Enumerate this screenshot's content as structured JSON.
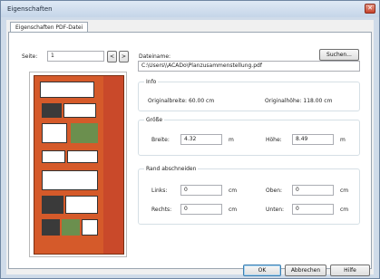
{
  "window": {
    "title": "Eigenschaften",
    "close_glyph": "✕"
  },
  "tab": {
    "label": "Eigenschaften PDF-Datei"
  },
  "page": {
    "label": "Seite:",
    "value": "1",
    "prev": "<",
    "next": ">"
  },
  "file": {
    "label": "Dateiname:",
    "path": "C:\\Users\\\\ACADo\\Planzusammenstellung.pdf",
    "browse": "Suchen..."
  },
  "info": {
    "title": "Info",
    "orig_width_label": "Originalbreite: 60.00 cm",
    "orig_height_label": "Originalhöhe:  118.00 cm"
  },
  "size": {
    "title": "Größe",
    "width_label": "Breite:",
    "width_value": "4.32",
    "width_unit": "m",
    "height_label": "Höhe:",
    "height_value": "8.49",
    "height_unit": "m"
  },
  "crop": {
    "title": "Rand abschneiden",
    "left_label": "Links:",
    "left_value": "0",
    "left_unit": "cm",
    "top_label": "Oben:",
    "top_value": "0",
    "top_unit": "cm",
    "right_label": "Rechts:",
    "right_value": "0",
    "right_unit": "cm",
    "bottom_label": "Unten:",
    "bottom_value": "0",
    "bottom_unit": "cm"
  },
  "buttons": {
    "ok": "OK",
    "cancel": "Abbrechen",
    "help": "Hilfe"
  },
  "colors": {
    "poster": "#d55a2a",
    "accent": "#3c7fb1"
  }
}
